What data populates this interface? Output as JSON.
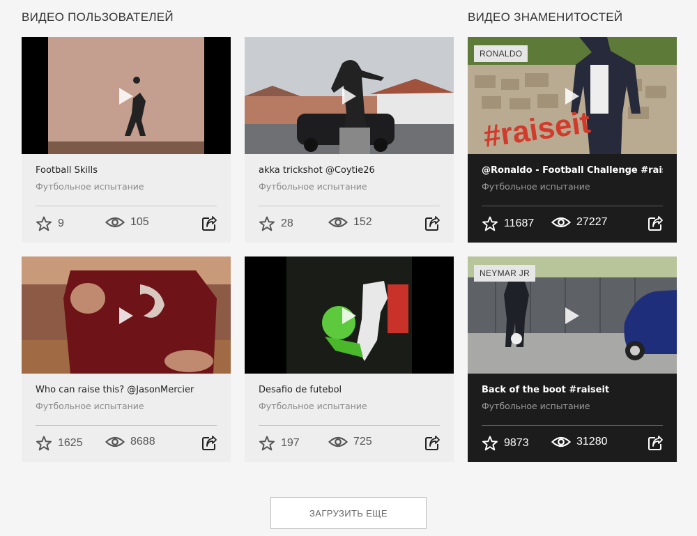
{
  "sections": {
    "user_videos_title": "ВИДЕО ПОЛЬЗОВАТЕЛЕЙ",
    "celebrity_videos_title": "ВИДЕО ЗНАМЕНИТОСТЕЙ"
  },
  "colors": {
    "light_card_bg": "#eeeeee",
    "dark_card_bg": "#1c1c1c",
    "page_bg": "#f5f5f5"
  },
  "icons": {
    "star": "star-icon",
    "views": "eye-icon",
    "share": "share-icon",
    "play": "play-icon"
  },
  "cards": [
    {
      "title": "Football Skills",
      "subtitle": "Футбольное испытание",
      "stars": "9",
      "views": "105",
      "tag": ""
    },
    {
      "title": "akka trickshot @Coytie26",
      "subtitle": "Футбольное испытание",
      "stars": "28",
      "views": "152",
      "tag": ""
    },
    {
      "title": "@Ronaldo - Football Challenge #raiseit",
      "subtitle": "Футбольное испытание",
      "stars": "11687",
      "views": "27227",
      "tag": "RONALDO"
    },
    {
      "title": "Who can raise this? @JasonMercier",
      "subtitle": "Футбольное испытание",
      "stars": "1625",
      "views": "8688",
      "tag": ""
    },
    {
      "title": "Desafio de futebol",
      "subtitle": "Футбольное испытание",
      "stars": "197",
      "views": "725",
      "tag": ""
    },
    {
      "title": "Back of the boot #raiseit",
      "subtitle": "Футбольное испытание",
      "stars": "9873",
      "views": "31280",
      "tag": "NEYMAR JR"
    }
  ],
  "load_more_label": "ЗАГРУЗИТЬ ЕЩЕ"
}
